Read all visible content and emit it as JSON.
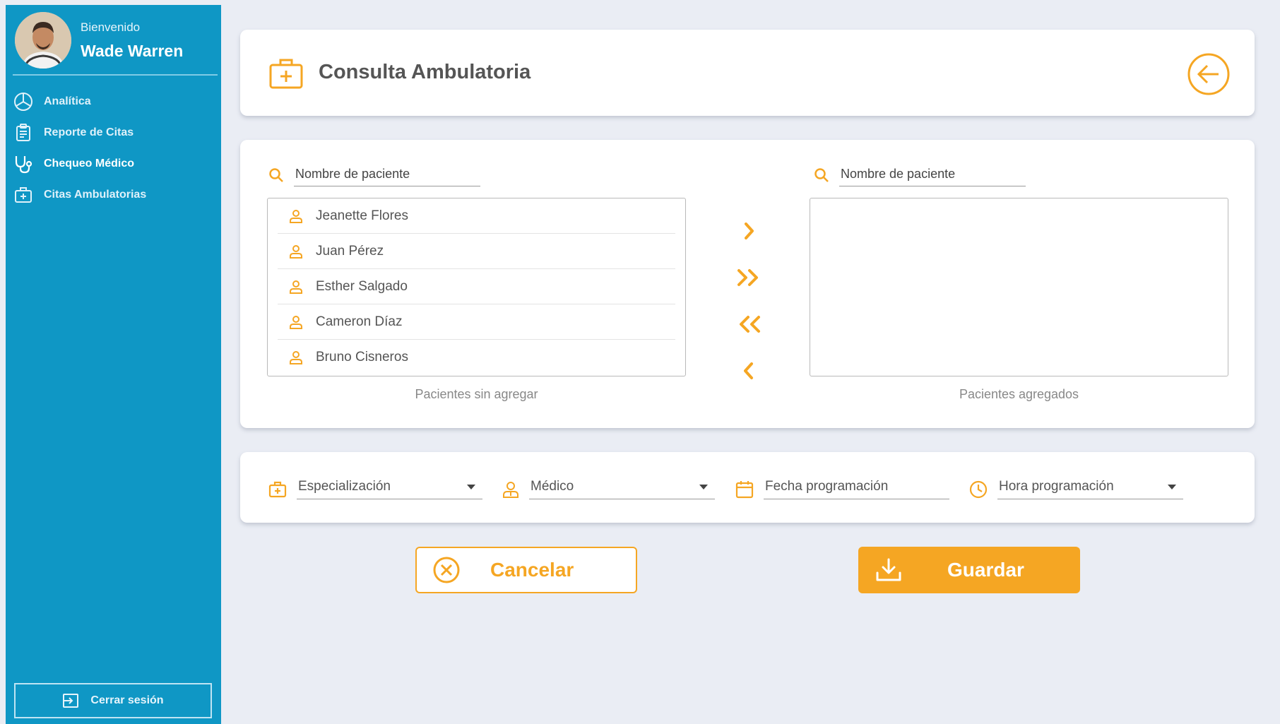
{
  "sidebar": {
    "welcome": "Bienvenido",
    "user_name": "Wade Warren",
    "nav": [
      {
        "label": "Analítica",
        "icon": "pie-chart-icon"
      },
      {
        "label": "Reporte de Citas",
        "icon": "clipboard-icon"
      },
      {
        "label": "Chequeo Médico",
        "icon": "stethoscope-icon",
        "active": true
      },
      {
        "label": "Citas Ambulatorias",
        "icon": "medical-case-icon"
      }
    ],
    "logout_label": "Cerrar sesión"
  },
  "header": {
    "title": "Consulta Ambulatoria"
  },
  "transfer": {
    "left_search_placeholder": "Nombre de paciente",
    "right_search_placeholder": "Nombre de paciente",
    "available_patients": [
      "Jeanette Flores",
      "Juan Pérez",
      "Esther Salgado",
      "Cameron Díaz",
      "Bruno Cisneros"
    ],
    "added_patients": [],
    "left_caption": "Pacientes sin agregar",
    "right_caption": "Pacientes agregados"
  },
  "form": {
    "specialization": "Especialización",
    "doctor": "Médico",
    "date": "Fecha programación",
    "time": "Hora programación"
  },
  "actions": {
    "cancel_label": "Cancelar",
    "save_label": "Guardar"
  },
  "colors": {
    "sidebar": "#0f97c5",
    "accent": "#f5a623",
    "background": "#eaedf4"
  }
}
